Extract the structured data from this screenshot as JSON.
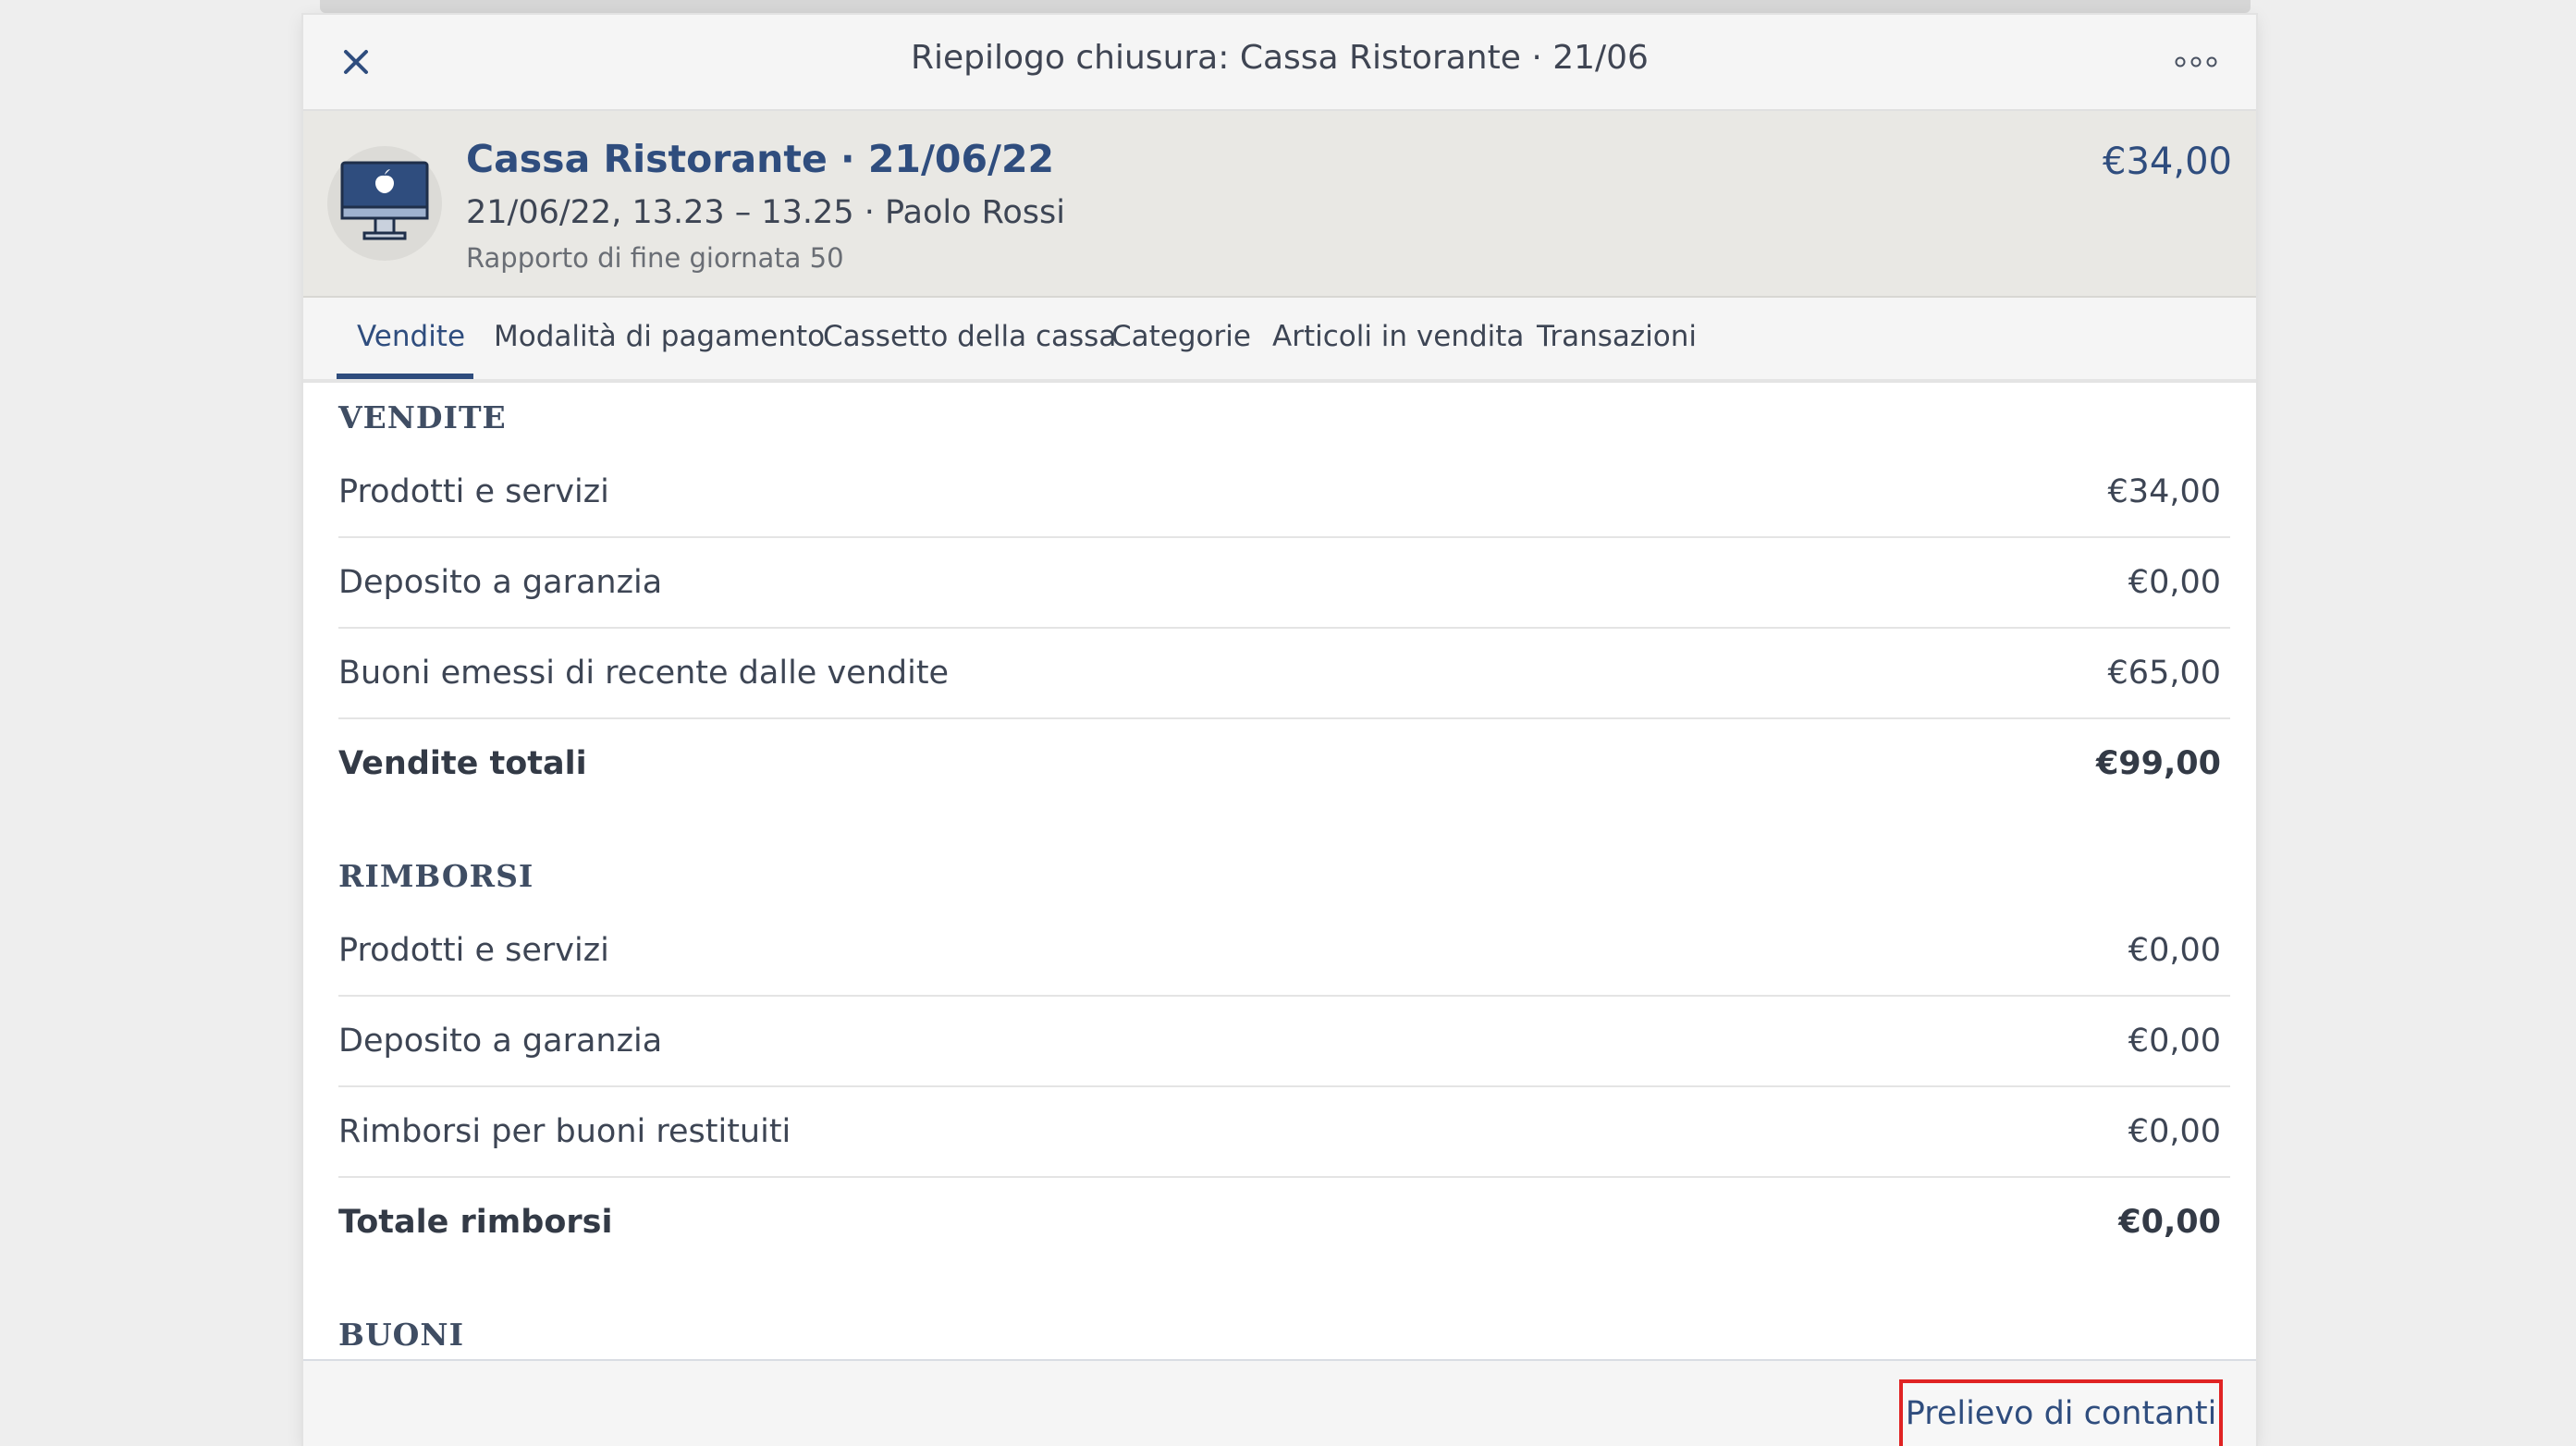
{
  "topbar": {
    "title": "Riepilogo chiusura: Cassa Ristorante · 21/06"
  },
  "header": {
    "title": "Cassa Ristorante · 21/06/22",
    "subtitle": "21/06/22, 13.23 – 13.25 · Paolo Rossi",
    "report": "Rapporto di fine giornata 50",
    "amount": "€34,00"
  },
  "tabs": [
    {
      "label": "Vendite",
      "active": true
    },
    {
      "label": "Modalità di pagamento"
    },
    {
      "label": "Cassetto della cassa"
    },
    {
      "label": "Categorie"
    },
    {
      "label": "Articoli in vendita"
    },
    {
      "label": "Transazioni"
    }
  ],
  "sections": {
    "vendite": {
      "heading": "VENDITE",
      "rows": [
        {
          "label": "Prodotti e servizi",
          "value": "€34,00"
        },
        {
          "label": "Deposito a garanzia",
          "value": "€0,00"
        },
        {
          "label": "Buoni emessi di recente dalle vendite",
          "value": "€65,00"
        }
      ],
      "total": {
        "label": "Vendite totali",
        "value": "€99,00"
      }
    },
    "rimborsi": {
      "heading": "RIMBORSI",
      "rows": [
        {
          "label": "Prodotti e servizi",
          "value": "€0,00"
        },
        {
          "label": "Deposito a garanzia",
          "value": "€0,00"
        },
        {
          "label": "Rimborsi per buoni restituiti",
          "value": "€0,00"
        }
      ],
      "total": {
        "label": "Totale rimborsi",
        "value": "€0,00"
      }
    },
    "buoni": {
      "heading": "BUONI"
    }
  },
  "footer": {
    "cash_button": "Prelievo di contanti"
  },
  "colors": {
    "accent": "#2f4d7e",
    "highlight_border": "#e02323"
  },
  "icons": {
    "close": "close-icon",
    "more": "more-options-icon",
    "device": "desktop-computer-icon"
  }
}
